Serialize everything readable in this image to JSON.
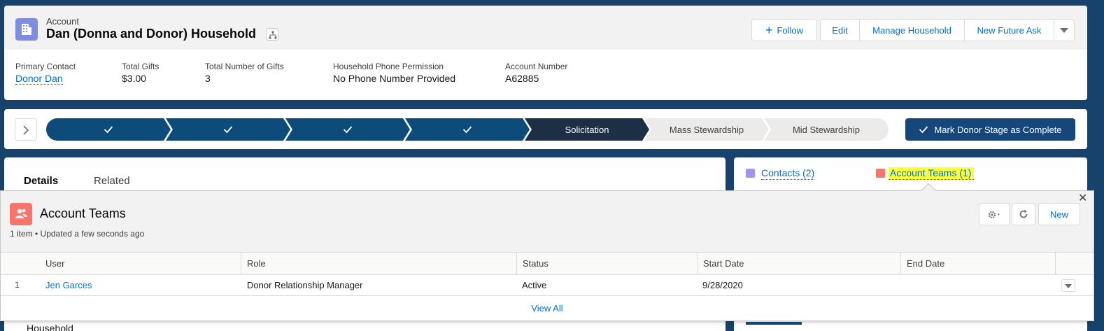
{
  "header": {
    "object_type": "Account",
    "title": "Dan (Donna and Donor) Household",
    "buttons": {
      "follow": "Follow",
      "edit": "Edit",
      "manage_household": "Manage Household",
      "new_future_ask": "New Future Ask"
    },
    "fields": [
      {
        "label": "Primary Contact",
        "value": "Donor Dan"
      },
      {
        "label": "Total Gifts",
        "value": "$3.00"
      },
      {
        "label": "Total Number of Gifts",
        "value": "3"
      },
      {
        "label": "Household Phone Permission",
        "value": "No Phone Number Provided"
      },
      {
        "label": "Account Number",
        "value": "A62885"
      }
    ]
  },
  "path": {
    "stages": [
      {
        "label": "",
        "state": "complete"
      },
      {
        "label": "",
        "state": "complete"
      },
      {
        "label": "",
        "state": "complete"
      },
      {
        "label": "",
        "state": "complete"
      },
      {
        "label": "Solicitation",
        "state": "current"
      },
      {
        "label": "Mass Stewardship",
        "state": "incomplete"
      },
      {
        "label": "Mid Stewardship",
        "state": "incomplete"
      }
    ],
    "mark_complete_label": "Mark Donor Stage as Complete"
  },
  "tabs": {
    "details": "Details",
    "related": "Related"
  },
  "left_card": {
    "partial_text": "Household"
  },
  "related_links": {
    "contacts": "Contacts (2)",
    "account_teams": "Account Teams (1)"
  },
  "popover": {
    "title": "Account Teams",
    "subtitle": "1 item • Updated a few seconds ago",
    "new_label": "New",
    "columns": [
      "User",
      "Role",
      "Status",
      "Start Date",
      "End Date"
    ],
    "rows": [
      {
        "num": "1",
        "user": "Jen Garces",
        "role": "Donor Relationship Manager",
        "status": "Active",
        "start_date": "9/28/2020",
        "end_date": ""
      }
    ],
    "view_all": "View All"
  },
  "colors": {
    "brand_dark": "#16426b",
    "path_complete": "#0d4b7a",
    "path_current": "#1e2e46",
    "link": "#006dcc",
    "highlight": "#ffff3a",
    "account_icon": "#7f8de1",
    "team_icon": "#f8756c"
  }
}
